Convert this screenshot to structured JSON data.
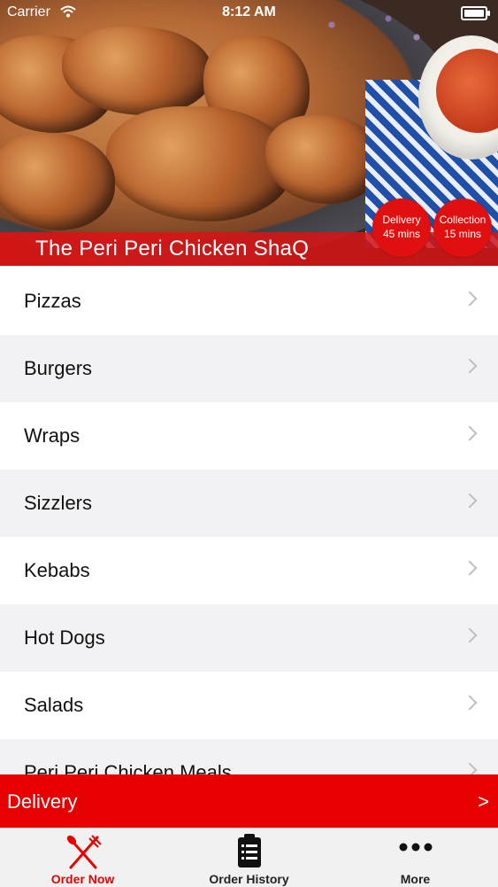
{
  "status_bar": {
    "carrier": "Carrier",
    "time": "8:12 AM"
  },
  "restaurant": {
    "name": "The Peri Peri Chicken ShaQ",
    "delivery": {
      "label": "Delivery",
      "time": "45 mins"
    },
    "collection": {
      "label": "Collection",
      "time": "15 mins"
    }
  },
  "menu": {
    "categories": [
      {
        "label": "Pizzas"
      },
      {
        "label": "Burgers"
      },
      {
        "label": "Wraps"
      },
      {
        "label": "Sizzlers"
      },
      {
        "label": "Kebabs"
      },
      {
        "label": "Hot Dogs"
      },
      {
        "label": "Salads"
      },
      {
        "label": "Peri Peri Chicken Meals"
      }
    ]
  },
  "order_bar": {
    "label": "Delivery",
    "arrow": ">"
  },
  "tabs": [
    {
      "label": "Order Now",
      "icon": "fork-knife-icon"
    },
    {
      "label": "Order History",
      "icon": "clipboard-icon"
    },
    {
      "label": "More",
      "icon": "more-dots-icon"
    }
  ],
  "colors": {
    "brand_red": "#e60000",
    "alt_row": "#f2f2f4"
  }
}
